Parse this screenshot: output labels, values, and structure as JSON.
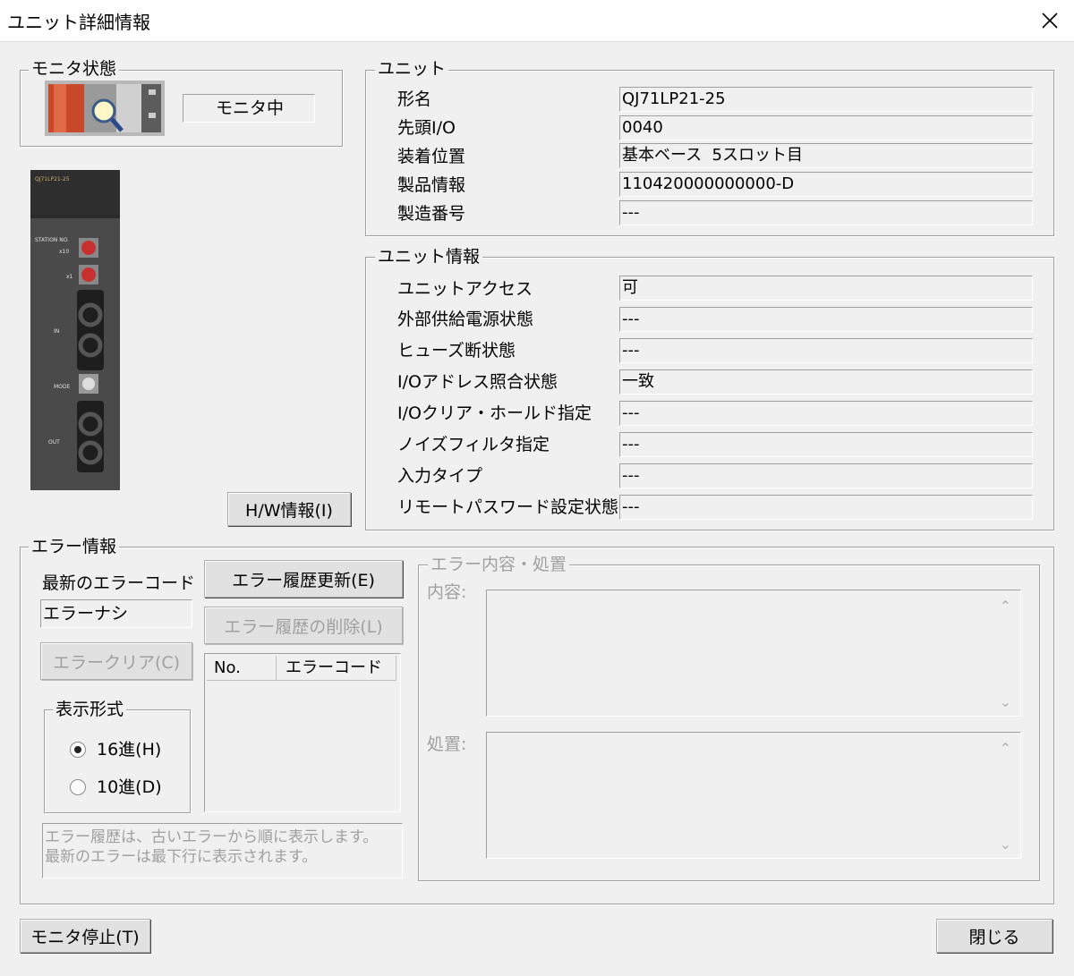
{
  "window": {
    "title": "ユニット詳細情報",
    "close_icon": "close-icon"
  },
  "monitor": {
    "group_label": "モニタ状態",
    "status": "モニタ中"
  },
  "unit": {
    "group_label": "ユニット",
    "rows": [
      {
        "label": "形名",
        "value": "QJ71LP21-25"
      },
      {
        "label": "先頭I/O",
        "value": "0040"
      },
      {
        "label": "装着位置",
        "value": "基本ベース  5スロット目"
      },
      {
        "label": "製品情報",
        "value": "110420000000000-D"
      },
      {
        "label": "製造番号",
        "value": "---"
      }
    ]
  },
  "unit_info": {
    "group_label": "ユニット情報",
    "rows": [
      {
        "label": "ユニットアクセス",
        "value": "可"
      },
      {
        "label": "外部供給電源状態",
        "value": "---"
      },
      {
        "label": "ヒューズ断状態",
        "value": "---"
      },
      {
        "label": "I/Oアドレス照合状態",
        "value": "一致"
      },
      {
        "label": "I/Oクリア・ホールド指定",
        "value": "---"
      },
      {
        "label": "ノイズフィルタ指定",
        "value": "---"
      },
      {
        "label": "入力タイプ",
        "value": "---"
      },
      {
        "label": "リモートパスワード設定状態",
        "value": "---"
      }
    ]
  },
  "module_image": {
    "model_text": "QJ71LP21-25",
    "station_label": "STATION NO.",
    "x10_label": "x10",
    "x1_label": "x1",
    "in_label": "IN",
    "mode_label": "MODE",
    "out_label": "OUT"
  },
  "hw_info_button": "H/W情報(I)",
  "error": {
    "group_label": "エラー情報",
    "latest_label": "最新のエラーコード",
    "latest_value": "エラーナシ",
    "clear_button": "エラークリア(C)",
    "update_button": "エラー履歴更新(E)",
    "delete_button": "エラー履歴の削除(L)",
    "table_headers": [
      "No.",
      "エラーコード"
    ],
    "display_format": {
      "label": "表示形式",
      "options": [
        {
          "label": "16進(H)",
          "selected": true
        },
        {
          "label": "10進(D)",
          "selected": false
        }
      ]
    },
    "note_line1": "エラー履歴は、古いエラーから順に表示します。",
    "note_line2": "最新のエラーは最下行に表示されます。",
    "detail": {
      "group_label": "エラー内容・処置",
      "content_label": "内容:",
      "action_label": "処置:"
    }
  },
  "footer": {
    "stop_button": "モニタ停止(T)",
    "close_button": "閉じる"
  }
}
